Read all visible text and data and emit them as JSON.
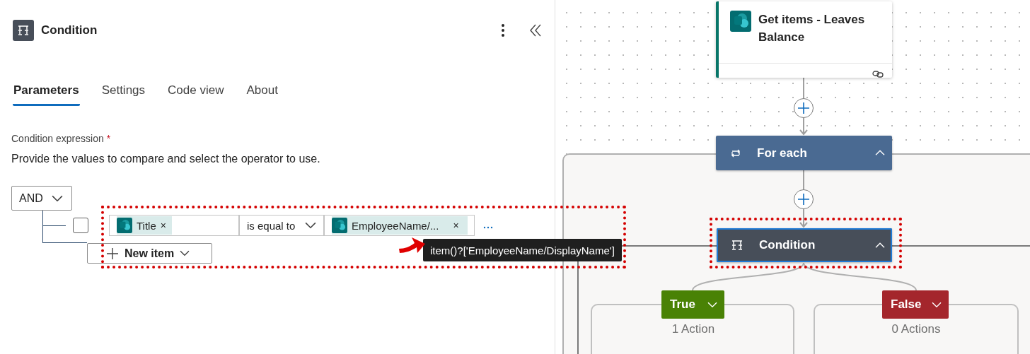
{
  "panel": {
    "title": "Condition",
    "tabs": [
      {
        "label": "Parameters",
        "selected": true
      },
      {
        "label": "Settings",
        "selected": false
      },
      {
        "label": "Code view",
        "selected": false
      },
      {
        "label": "About",
        "selected": false
      }
    ],
    "field_label": "Condition expression",
    "required_mark": "*",
    "description": "Provide the values to compare and select the operator to use.",
    "group_operator": "AND",
    "rows": [
      {
        "checked": false,
        "left_token": "Title",
        "operator": "is equal to",
        "right_token": "EmployeeName/...",
        "remove": "×"
      }
    ],
    "new_item_button": "New item"
  },
  "tooltip": "item()?['EmployeeName/DisplayName']",
  "canvas": {
    "nodes": [
      {
        "kind": "action",
        "title": "Get items - Leaves Balance",
        "selected": false
      },
      {
        "kind": "loop",
        "title": "For each",
        "expanded": true,
        "selected": false
      },
      {
        "kind": "condition",
        "title": "Condition",
        "expanded": true,
        "selected": true
      }
    ],
    "branches": [
      {
        "label": "True",
        "color": "#498205",
        "summary": "1 Action",
        "expanded": false
      },
      {
        "label": "False",
        "color": "#a4262c",
        "summary": "0 Actions",
        "expanded": false
      }
    ]
  }
}
